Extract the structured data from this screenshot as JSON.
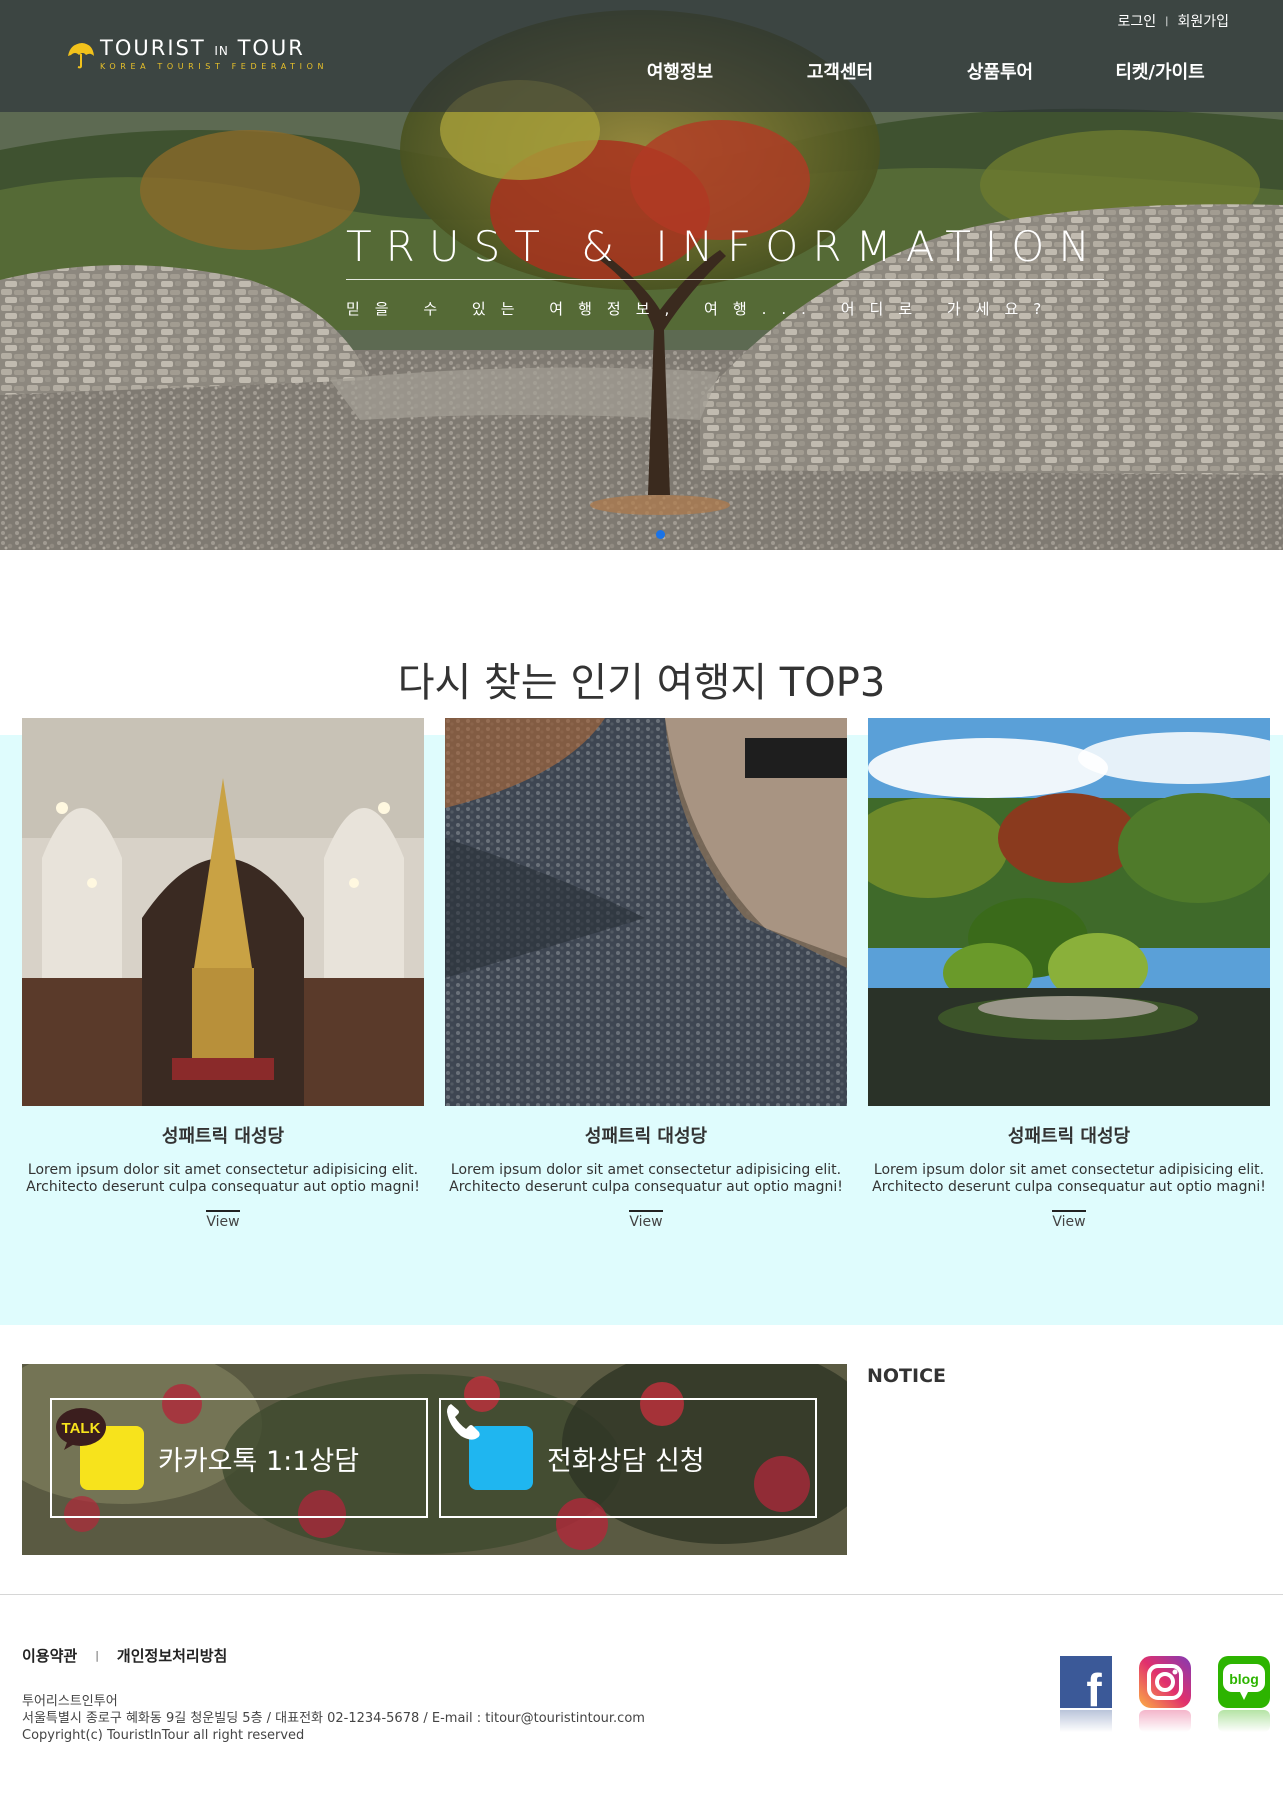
{
  "header": {
    "logo": {
      "main": "TOURIST",
      "in": "IN",
      "tour": "TOUR",
      "sub": "KOREA TOURIST FEDERATION"
    },
    "util": {
      "login": "로그인",
      "join": "회원가입"
    },
    "nav": [
      "여행정보",
      "고객센터",
      "상품투어",
      "티켓/가이트"
    ]
  },
  "hero": {
    "title": "TRUST & INFORMATION",
    "subtitle": "믿을 수 있는 여행정보, 여행... 어디로 가세요?",
    "slide_count": 1,
    "active_slide": 1,
    "accent_color": "#1a73e8"
  },
  "top3": {
    "title": "다시 찾는 인기 여행지 TOP3",
    "background": "#dffcfd",
    "cards": [
      {
        "name": "성패트릭 대성당",
        "desc_line1": "Lorem ipsum dolor sit amet consectetur adipisicing elit.",
        "desc_line2": "Architecto deserunt culpa consequatur aut optio magni!",
        "view": "View"
      },
      {
        "name": "성패트릭 대성당",
        "desc_line1": "Lorem ipsum dolor sit amet consectetur adipisicing elit.",
        "desc_line2": "Architecto deserunt culpa consequatur aut optio magni!",
        "view": "View"
      },
      {
        "name": "성패트릭 대성당",
        "desc_line1": "Lorem ipsum dolor sit amet consectetur adipisicing elit.",
        "desc_line2": "Architecto deserunt culpa consequatur aut optio magni!",
        "view": "View"
      }
    ]
  },
  "contact": {
    "kakao": {
      "label": "카카오톡 1:1상담",
      "icon": "TALK"
    },
    "phone": {
      "label": "전화상담 신청"
    }
  },
  "notice": {
    "title": "NOTICE"
  },
  "footer": {
    "links": [
      "이용약관",
      "개인정보처리방침"
    ],
    "company": "투어리스트인투어",
    "address": "서울특별시 종로구 혜화동 9길 청운빌딩 5층 / 대표전화 02-1234-5678 / E-mail : titour@touristintour.com",
    "copyright": "Copyright(c) TouristInTour all right reserved",
    "sns": {
      "facebook": "f",
      "instagram": "instagram",
      "blog": "blog"
    }
  }
}
